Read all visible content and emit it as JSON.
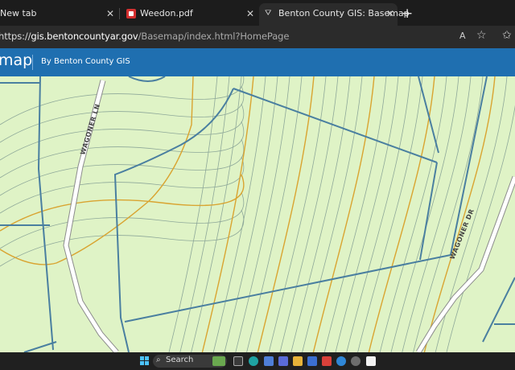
{
  "browser": {
    "tabs": [
      {
        "title": "New tab",
        "active": false
      },
      {
        "title": "Weedon.pdf",
        "active": false
      },
      {
        "title": "Benton County GIS: Basemap",
        "active": true
      }
    ],
    "close_glyph": "✕",
    "new_tab_glyph": "+",
    "address": {
      "prefix": "https://",
      "host": "gis.bentoncountyar.gov",
      "path": "/Basemap/index.html?HomePage"
    },
    "read_aloud_glyph": "A",
    "favorite_glyph": "☆",
    "collections_glyph": "✩"
  },
  "app": {
    "title": "map",
    "subtitle": "By Benton County GIS"
  },
  "map": {
    "colors": {
      "background": "#dff3c6",
      "contour": "#8ea899",
      "index_contour": "#d9a431",
      "parcel": "#4a7fa0",
      "road_fill": "#ffffff",
      "road_edge": "#8c8c8c"
    },
    "road_labels": {
      "left": "WAGONER LN",
      "right": "WAGONER DR"
    }
  },
  "taskbar": {
    "search_label": "Search",
    "search_glyph": "⌕",
    "icons": [
      "windows-icon",
      "widgets-icon",
      "task-view-icon",
      "edge-icon",
      "store-icon",
      "explorer-icon",
      "mail-icon",
      "teams-icon",
      "help-icon",
      "settings-icon",
      "app-icon"
    ]
  }
}
